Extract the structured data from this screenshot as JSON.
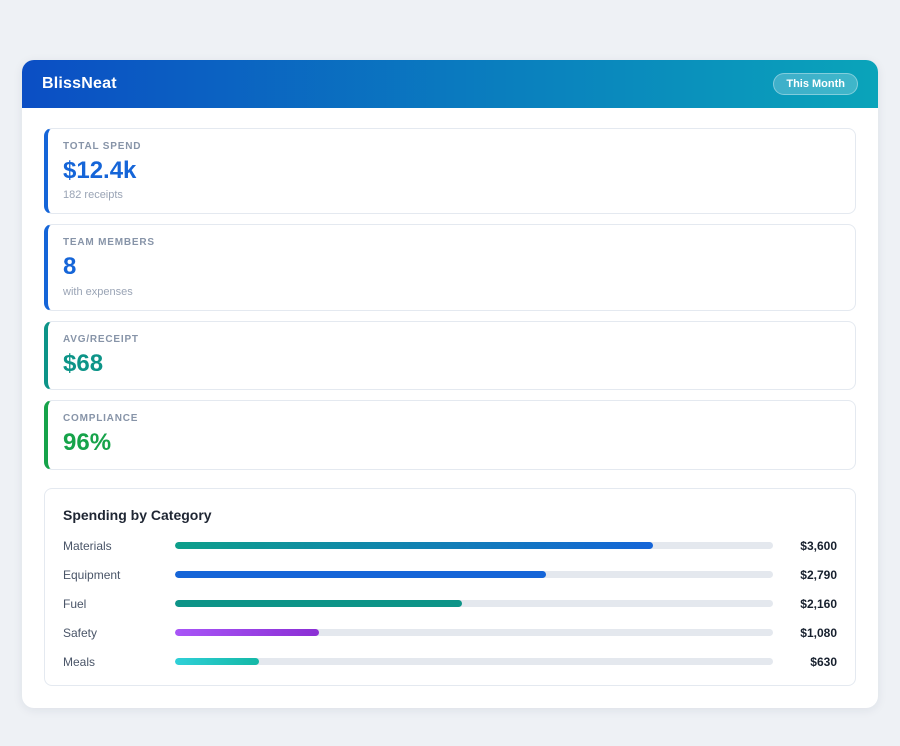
{
  "app": {
    "title": "BlissNeat",
    "period_badge": "This Month"
  },
  "colors": {
    "header_gradient_from": "#0b4ec4",
    "header_gradient_to": "#0aa4ba",
    "blue": "#1565d8",
    "teal": "#0d9488",
    "green": "#16a34a",
    "purple": "#9333ea"
  },
  "stats": [
    {
      "label": "TOTAL SPEND",
      "value": "$12.4k",
      "subtitle": "182 receipts",
      "accent": "#1565d8",
      "value_color": "#1565d8"
    },
    {
      "label": "TEAM MEMBERS",
      "value": "8",
      "subtitle": "with expenses",
      "accent": "#1565d8",
      "value_color": "#1565d8"
    },
    {
      "label": "AVG/RECEIPT",
      "value": "$68",
      "subtitle": "",
      "accent": "#0d9488",
      "value_color": "#0d9488"
    },
    {
      "label": "COMPLIANCE",
      "value": "96%",
      "subtitle": "",
      "accent": "#16a34a",
      "value_color": "#16a34a"
    }
  ],
  "chart_data": {
    "type": "bar",
    "title": "Spending by Category",
    "categories": [
      "Materials",
      "Equipment",
      "Fuel",
      "Safety",
      "Meals"
    ],
    "values": [
      3600,
      2790,
      2160,
      1080,
      630
    ],
    "value_labels": [
      "$3,600",
      "$2,790",
      "$2,160",
      "$1,080",
      "$630"
    ],
    "max": 4500,
    "bar_colors": [
      "linear-gradient(90deg, #0d9f8a, #1565d8)",
      "#1565d8",
      "#0d9488",
      "linear-gradient(90deg, #a855f7, #8b2fd4)",
      "linear-gradient(90deg, #2fd0d8, #14b8a6)"
    ],
    "track_color": "#e4e8ee"
  }
}
